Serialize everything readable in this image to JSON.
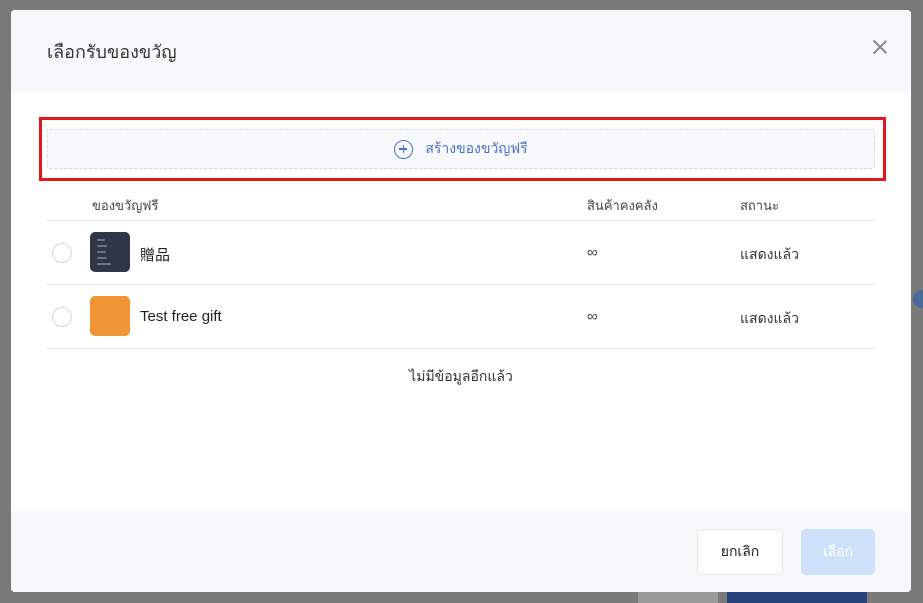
{
  "dialog": {
    "title": "เลือกรับของขวัญ",
    "create_button_label": "สร้างของขวัญฟรี"
  },
  "table": {
    "columns": {
      "name": "ของขวัญฟรี",
      "stock": "สินค้าคงคลัง",
      "status": "สถานะ"
    },
    "rows": [
      {
        "name": "贈品",
        "stock": "∞",
        "status": "แสดงแล้ว",
        "thumb_color": "#2f3646"
      },
      {
        "name": "Test free gift",
        "stock": "∞",
        "status": "แสดงแล้ว",
        "thumb_color": "#f09535"
      }
    ],
    "no_more_text": "ไม่มีข้อมูลอีกแล้ว"
  },
  "footer": {
    "cancel_label": "ยกเลิก",
    "select_label": "เลือก"
  },
  "colors": {
    "accent": "#4a72c9",
    "highlight": "#e2171f",
    "select_disabled": "#cfe0fb"
  }
}
